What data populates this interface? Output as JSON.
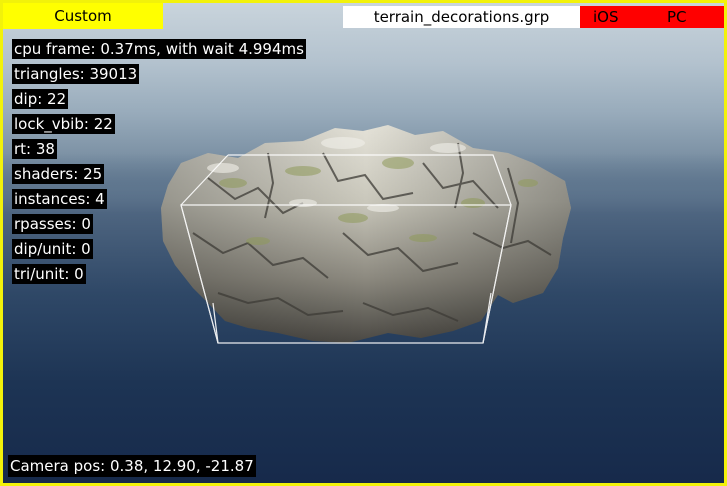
{
  "toolbar": {
    "preset_label": "Custom",
    "file_name": "terrain_decorations.grp",
    "platform_ios": "iOS",
    "platform_pc": "PC"
  },
  "stats": [
    "cpu frame: 0.37ms, with wait 4.994ms",
    "triangles: 39013",
    "dip: 22",
    "lock_vbib: 22",
    "rt: 38",
    "shaders: 25",
    "instances: 4",
    "rpasses: 0",
    "dip/unit: 0",
    "tri/unit: 0"
  ],
  "camera": {
    "position_text": "Camera pos: 0.38, 12.90, -21.87"
  },
  "colors": {
    "border": "#f2f20a",
    "preset_bg": "#ffff00",
    "platform_bg": "#ff0000",
    "stat_bg": "#000000",
    "stat_text": "#ffffff"
  }
}
